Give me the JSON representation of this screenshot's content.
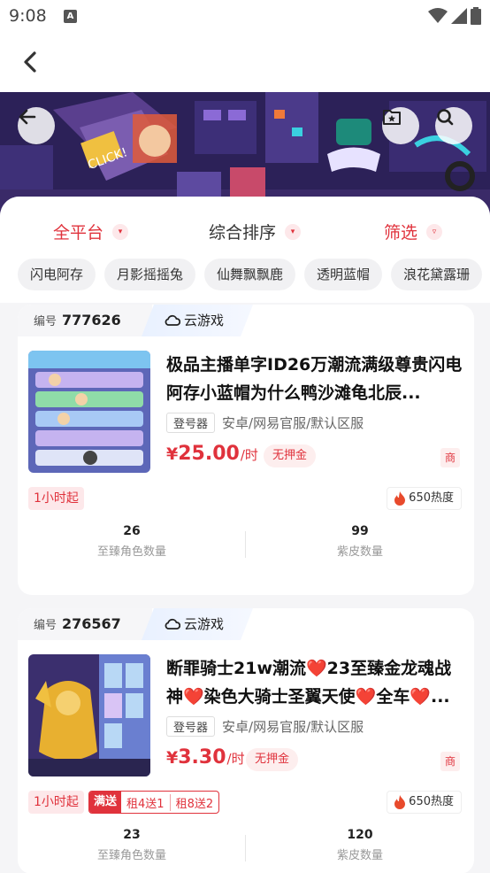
{
  "status_bar": {
    "time": "9:08",
    "notif_letter": "A"
  },
  "filters": {
    "platform": "全平台",
    "sort": "综合排序",
    "screen": "筛选"
  },
  "chips": [
    "闪电阿存",
    "月影摇摇兔",
    "仙舞飘飘鹿",
    "透明蓝帽",
    "浪花黛露珊"
  ],
  "cards": [
    {
      "id_label": "编号",
      "id": "777626",
      "cloud": "云游戏",
      "title": "极品主播单字ID26万潮流满级尊贵闪电阿存小蓝帽为什么鸭沙滩龟北辰...",
      "login": "登号器",
      "server": "安卓/网易官服/默认区服",
      "currency": "¥",
      "price": "25.00",
      "unit": "/时",
      "deposit": "无押金",
      "shang": "商",
      "min_hours": "1小时起",
      "heat": "650热度",
      "stats": [
        {
          "value": "26",
          "label": "至臻角色数量"
        },
        {
          "value": "99",
          "label": "紫皮数量"
        }
      ]
    },
    {
      "id_label": "编号",
      "id": "276567",
      "cloud": "云游戏",
      "title": "断罪骑士21w潮流❤️23至臻金龙魂战神❤️染色大骑士圣翼天使❤️全车❤️...",
      "login": "登号器",
      "server": "安卓/网易官服/默认区服",
      "currency": "¥",
      "price": "3.30",
      "unit": "/时",
      "deposit": "无押金",
      "shang": "商",
      "min_hours": "1小时起",
      "promo": {
        "tag": "满送",
        "offer1": "租4送1",
        "offer2": "租8送2"
      },
      "heat": "650热度",
      "stats": [
        {
          "value": "23",
          "label": "至臻角色数量"
        },
        {
          "value": "120",
          "label": "紫皮数量"
        }
      ]
    }
  ],
  "colors": {
    "accent": "#e0323c",
    "cloud_bg": "#e9f1ff"
  }
}
